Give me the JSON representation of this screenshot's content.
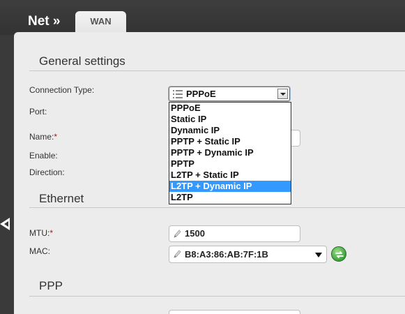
{
  "header": {
    "breadcrumb": "Net »",
    "tab_label": "WAN"
  },
  "sections": {
    "general": "General settings",
    "ethernet": "Ethernet",
    "ppp": "PPP"
  },
  "fields": {
    "connection_type": {
      "label": "Connection Type:",
      "value": "PPPoE"
    },
    "port": {
      "label": "Port:"
    },
    "name": {
      "label": "Name:",
      "required_mark": "*"
    },
    "enable": {
      "label": "Enable:"
    },
    "direction": {
      "label": "Direction:"
    },
    "mtu": {
      "label": "MTU:",
      "required_mark": "*",
      "value": "1500"
    },
    "mac": {
      "label": "MAC:",
      "value": "B8:A3:86:AB:7F:1B"
    }
  },
  "connection_type_options": [
    "PPPoE",
    "Static IP",
    "Dynamic IP",
    "PPTP + Static IP",
    "PPTP + Dynamic IP",
    "PPTP",
    "L2TP + Static IP",
    "L2TP + Dynamic IP",
    "L2TP"
  ],
  "highlighted_option": "L2TP + Dynamic IP",
  "colors": {
    "highlight": "#3399ff",
    "required": "#dd0000",
    "refresh": "#3aa13a"
  },
  "icons": [
    "pencil-icon",
    "list-icon",
    "chevron-down-icon",
    "refresh-icon",
    "back-arrow-icon"
  ]
}
